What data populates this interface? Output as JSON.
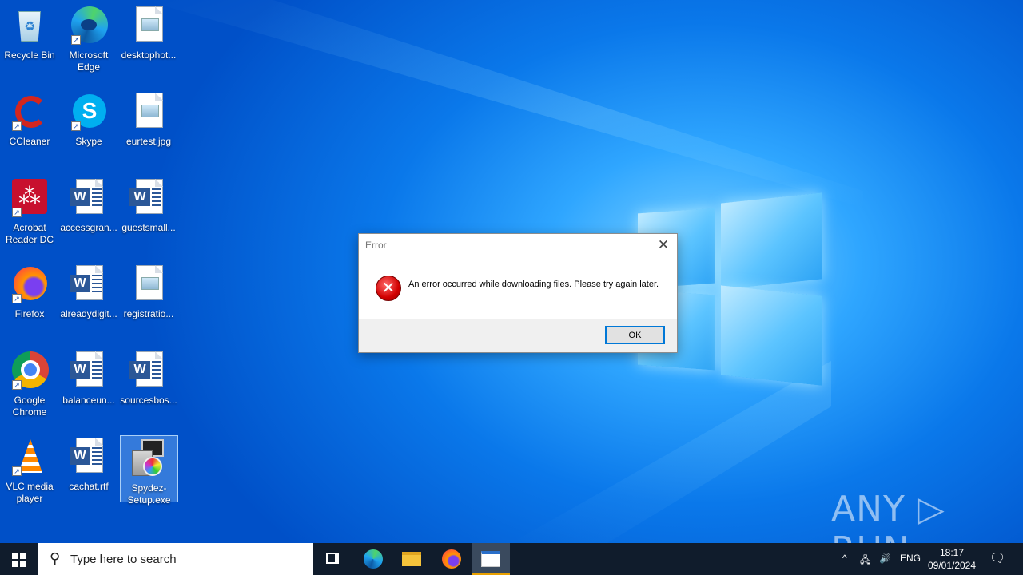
{
  "desktop": {
    "icons": [
      {
        "label": "Recycle Bin"
      },
      {
        "label": "Microsoft Edge"
      },
      {
        "label": "desktophot..."
      },
      {
        "label": "CCleaner"
      },
      {
        "label": "Skype"
      },
      {
        "label": "eurtest.jpg"
      },
      {
        "label": "Acrobat Reader DC"
      },
      {
        "label": "accessgran..."
      },
      {
        "label": "guestsmall..."
      },
      {
        "label": "Firefox"
      },
      {
        "label": "alreadydigit..."
      },
      {
        "label": "registratio..."
      },
      {
        "label": "Google Chrome"
      },
      {
        "label": "balanceun..."
      },
      {
        "label": "sourcesbos..."
      },
      {
        "label": "VLC media player"
      },
      {
        "label": "cachat.rtf"
      },
      {
        "label": "Spydez-Setup.exe"
      }
    ],
    "watermark": "ANY ▷ RUN"
  },
  "dialog": {
    "title": "Error",
    "close_glyph": "✕",
    "icon_glyph": "✕",
    "message": "An error occurred while downloading files. Please try again later.",
    "ok_label": "OK"
  },
  "taskbar": {
    "search_placeholder": "Type here to search",
    "search_glyph": "⚲",
    "tray": {
      "chevron": "^",
      "network": "🖧",
      "volume": "🔊",
      "language": "ENG",
      "notification": "🗨"
    },
    "clock": {
      "time": "18:17",
      "date": "09/01/2024"
    }
  }
}
